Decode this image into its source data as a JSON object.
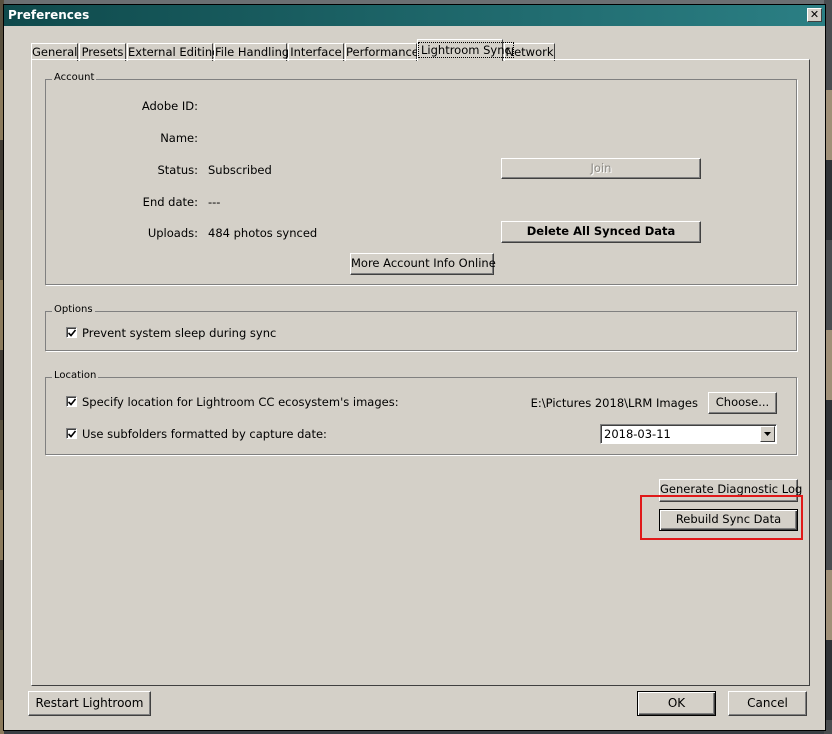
{
  "window": {
    "title": "Preferences",
    "close_glyph": "✕"
  },
  "tabs": [
    {
      "label": "General"
    },
    {
      "label": "Presets"
    },
    {
      "label": "External Editing"
    },
    {
      "label": "File Handling"
    },
    {
      "label": "Interface"
    },
    {
      "label": "Performance"
    },
    {
      "label": "Lightroom Sync",
      "active": true
    },
    {
      "label": "Network"
    }
  ],
  "account": {
    "group_title": "Account",
    "adobe_id_label": "Adobe ID:",
    "adobe_id_value": "",
    "name_label": "Name:",
    "name_value": "",
    "status_label": "Status:",
    "status_value": "Subscribed",
    "end_date_label": "End date:",
    "end_date_value": "---",
    "uploads_label": "Uploads:",
    "uploads_value": "484 photos synced",
    "join_button": "Join",
    "delete_button": "Delete All Synced Data",
    "more_info_button": "More Account Info Online"
  },
  "options": {
    "group_title": "Options",
    "prevent_sleep_label": "Prevent system sleep during sync",
    "prevent_sleep_checked": true
  },
  "location": {
    "group_title": "Location",
    "specify_label": "Specify location for Lightroom CC ecosystem's images:",
    "specify_checked": true,
    "path_value": "E:\\Pictures 2018\\LRM Images",
    "choose_button": "Choose...",
    "subfolders_label": "Use subfolders formatted by capture date:",
    "subfolders_checked": true,
    "date_format_value": "2018-03-11"
  },
  "actions": {
    "diagnostic_button": "Generate Diagnostic Log",
    "rebuild_button": "Rebuild Sync Data"
  },
  "footer": {
    "restart_button": "Restart Lightroom",
    "ok_button": "OK",
    "cancel_button": "Cancel"
  },
  "colors": {
    "titlebar_start": "#0f4a4c",
    "titlebar_end": "#2b7f84",
    "dialog_bg": "#d4d0c8",
    "highlight": "#e01919"
  },
  "icons": {
    "checkbox": "checkmark-icon",
    "dropdown": "chevron-down-icon",
    "close": "close-icon"
  }
}
